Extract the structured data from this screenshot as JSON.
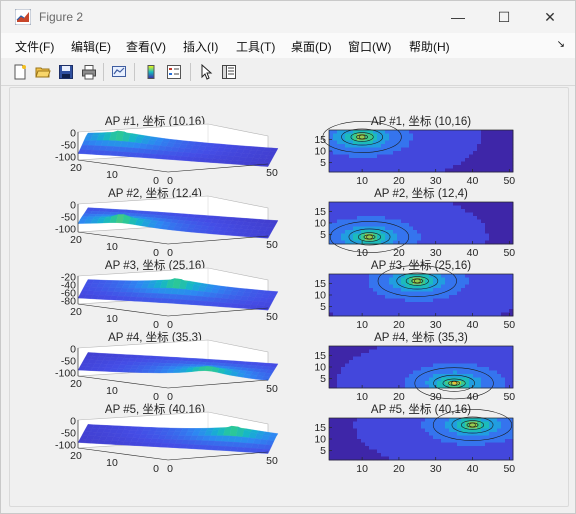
{
  "window": {
    "title": "Figure 2",
    "controls": {
      "minimize": "—",
      "maximize": "☐",
      "close": "✕"
    }
  },
  "menu": [
    {
      "label": "文件(F)"
    },
    {
      "label": "编辑(E)"
    },
    {
      "label": "查看(V)"
    },
    {
      "label": "插入(I)"
    },
    {
      "label": "工具(T)"
    },
    {
      "label": "桌面(D)"
    },
    {
      "label": "窗口(W)"
    },
    {
      "label": "帮助(H)"
    }
  ],
  "menu_overflow": "↘",
  "toolbar": [
    {
      "icon": "new-figure-icon"
    },
    {
      "icon": "open-file-icon"
    },
    {
      "icon": "save-icon"
    },
    {
      "icon": "print-icon"
    },
    {
      "icon": "link-plot-icon"
    },
    {
      "icon": "colorbar-icon"
    },
    {
      "icon": "legend-icon"
    },
    {
      "icon": "edit-pointer-icon"
    },
    {
      "icon": "property-inspector-icon"
    }
  ],
  "colors": {
    "parula_low": "#3e26a8",
    "parula_mid": "#17bbc0",
    "parula_high": "#f9fb0e"
  },
  "chart_data": [
    {
      "type": "surface",
      "title": "AP #1, 坐标 (10,16)",
      "z_ticks": [
        "0",
        "-50",
        "-100"
      ],
      "y_ticks": [
        "20",
        "10",
        "0"
      ],
      "x_ticks": [
        "0",
        "50"
      ],
      "peak": [
        10,
        16
      ]
    },
    {
      "type": "heatmap",
      "title": "AP #1, 坐标 (10,16)",
      "y_ticks": [
        "15",
        "10",
        "5"
      ],
      "x_ticks": [
        "10",
        "20",
        "30",
        "40",
        "50"
      ],
      "peak": [
        10,
        16
      ]
    },
    {
      "type": "surface",
      "title": "AP #2, 坐标 (12,4)",
      "z_ticks": [
        "0",
        "-50",
        "-100"
      ],
      "y_ticks": [
        "20",
        "10",
        "0"
      ],
      "x_ticks": [
        "0",
        "50"
      ],
      "peak": [
        12,
        4
      ]
    },
    {
      "type": "heatmap",
      "title": "AP #2, 坐标 (12,4)",
      "y_ticks": [
        "15",
        "10",
        "5"
      ],
      "x_ticks": [
        "10",
        "20",
        "30",
        "40",
        "50"
      ],
      "peak": [
        12,
        4
      ]
    },
    {
      "type": "surface",
      "title": "AP #3, 坐标 (25,16)",
      "z_ticks": [
        "-20",
        "-40",
        "-60",
        "-80"
      ],
      "y_ticks": [
        "20",
        "10",
        "0"
      ],
      "x_ticks": [
        "0",
        "50"
      ],
      "peak": [
        25,
        16
      ]
    },
    {
      "type": "heatmap",
      "title": "AP #3, 坐标 (25,16)",
      "y_ticks": [
        "15",
        "10",
        "5"
      ],
      "x_ticks": [
        "10",
        "20",
        "30",
        "40",
        "50"
      ],
      "peak": [
        25,
        16
      ]
    },
    {
      "type": "surface",
      "title": "AP #4, 坐标 (35,3)",
      "z_ticks": [
        "0",
        "-50",
        "-100"
      ],
      "y_ticks": [
        "20",
        "10",
        "0"
      ],
      "x_ticks": [
        "0",
        "50"
      ],
      "peak": [
        35,
        3
      ]
    },
    {
      "type": "heatmap",
      "title": "AP #4, 坐标 (35,3)",
      "y_ticks": [
        "15",
        "10",
        "5"
      ],
      "x_ticks": [
        "10",
        "20",
        "30",
        "40",
        "50"
      ],
      "peak": [
        35,
        3
      ]
    },
    {
      "type": "surface",
      "title": "AP #5, 坐标 (40,16)",
      "z_ticks": [
        "0",
        "-50",
        "-100"
      ],
      "y_ticks": [
        "20",
        "10",
        "0"
      ],
      "x_ticks": [
        "0",
        "50"
      ],
      "peak": [
        40,
        16
      ]
    },
    {
      "type": "heatmap",
      "title": "AP #5, 坐标 (40,16)",
      "y_ticks": [
        "15",
        "10",
        "5"
      ],
      "x_ticks": [
        "10",
        "20",
        "30",
        "40",
        "50"
      ],
      "peak": [
        40,
        16
      ]
    }
  ]
}
